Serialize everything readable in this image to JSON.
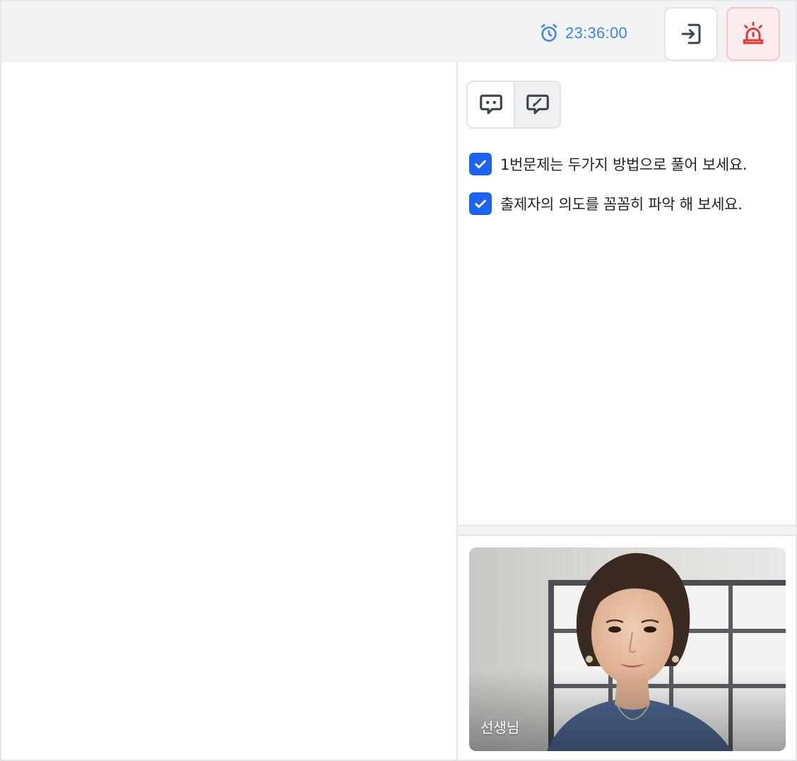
{
  "header": {
    "timer": {
      "icon": "alarm-clock-icon",
      "time": "23:36:00"
    },
    "exit_button": {
      "icon": "exit-icon"
    },
    "emergency_button": {
      "icon": "siren-icon"
    }
  },
  "sidebar": {
    "mode_toggle": [
      {
        "icon": "chat-bubble-icon"
      },
      {
        "icon": "edit-bubble-icon"
      }
    ],
    "tasks": [
      {
        "text": "1번문제는 두가지 방법으로 풀어 보세요.",
        "checked": true
      },
      {
        "text": "출제자의 의도를 꼼꼼히 파악 해 보세요.",
        "checked": true
      }
    ]
  },
  "video": {
    "label": "선생님"
  },
  "colors": {
    "accent": "#1d63f5",
    "timer": "#3b82f6",
    "alarm": "#e53935",
    "toolbar_bg": "#f2f3f5"
  }
}
